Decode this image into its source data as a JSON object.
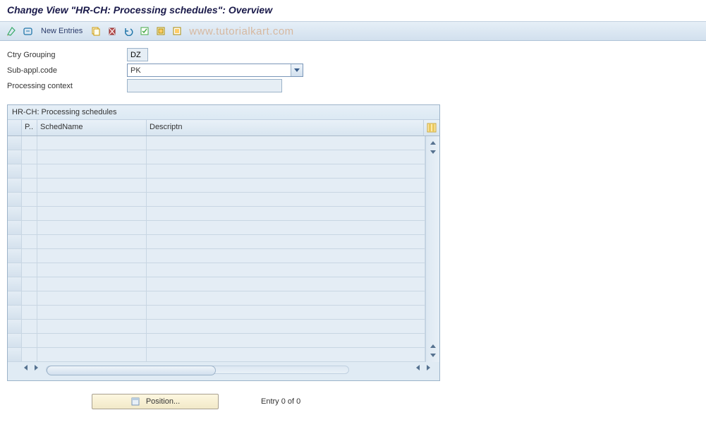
{
  "title": "Change View \"HR-CH: Processing schedules\": Overview",
  "toolbar": {
    "new_entries": "New Entries"
  },
  "watermark": "www.tutorialkart.com",
  "form": {
    "ctry_label": "Ctry Grouping",
    "ctry_value": "DZ",
    "subappl_label": "Sub-appl.code",
    "subappl_value": "PK",
    "procctx_label": "Processing context",
    "procctx_value": ""
  },
  "table": {
    "title": "HR-CH: Processing schedules",
    "headers": {
      "p": "P..",
      "sched": "SchedName",
      "desc": "Descriptn"
    },
    "rows": 16
  },
  "footer": {
    "position": "Position...",
    "entry": "Entry 0 of 0"
  }
}
